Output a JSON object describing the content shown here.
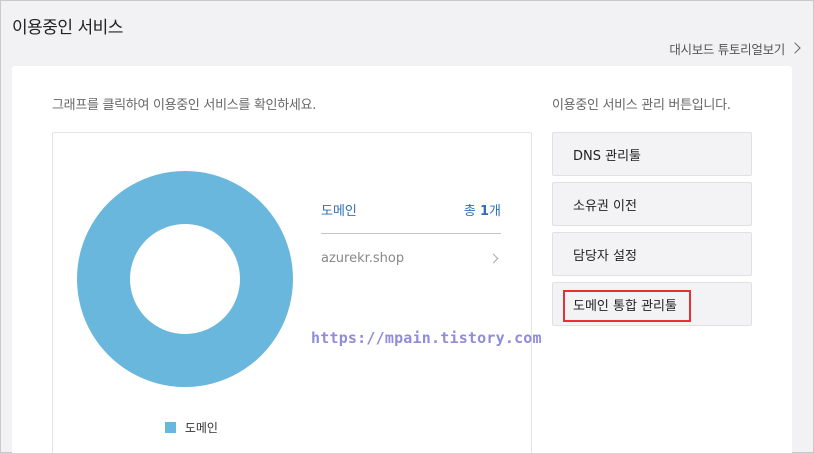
{
  "page": {
    "title": "이용중인 서비스",
    "tutorial_link": "대시보드 튜토리얼보기"
  },
  "chart_panel": {
    "hint": "그래프를 클릭하여 이용중인 서비스를 확인하세요.",
    "legend_label": "도메인",
    "category": "도메인",
    "total_prefix": "총 ",
    "total_count": "1",
    "total_suffix": "개",
    "items": [
      {
        "name": "azurekr.shop"
      }
    ]
  },
  "chart_data": {
    "type": "pie",
    "labels": [
      "도메인"
    ],
    "values": [
      1
    ],
    "colors": [
      "#69b7dc"
    ],
    "legend": "bottom"
  },
  "actions": {
    "hint": "이용중인 서비스 관리 버튼입니다.",
    "buttons": [
      {
        "label": "DNS 관리툴",
        "highlighted": false
      },
      {
        "label": "소유권 이전",
        "highlighted": false
      },
      {
        "label": "담당자 설정",
        "highlighted": false
      },
      {
        "label": "도메인 통합 관리툴",
        "highlighted": true
      }
    ]
  },
  "watermark": "https://mpain.tistory.com",
  "colors": {
    "accent": "#2f6fb6",
    "donut": "#69b7dc",
    "highlight_border": "#e53131",
    "watermark": "#8f8cd8"
  },
  "icons": [
    "chevron-right-icon"
  ]
}
